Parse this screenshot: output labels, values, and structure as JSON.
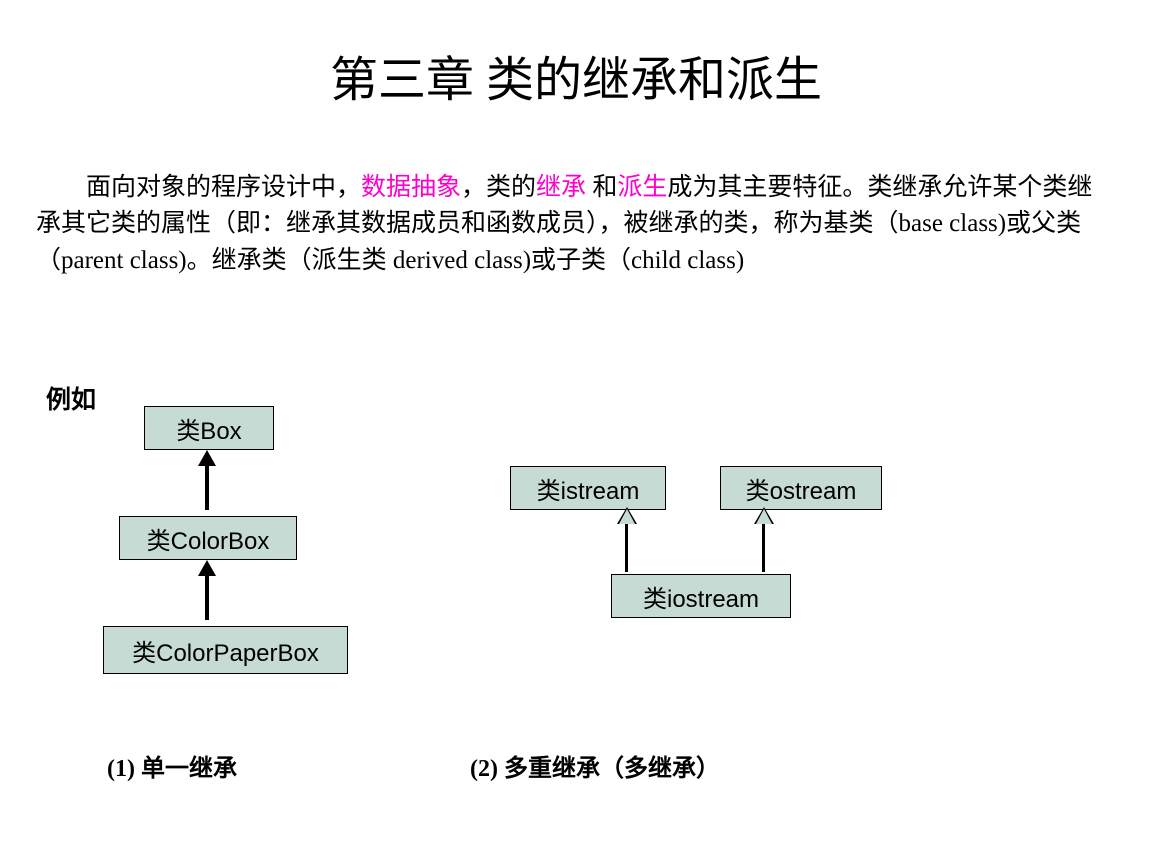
{
  "title": "第三章 类的继承和派生",
  "intro": {
    "seg1": "面向对象的程序设计中，",
    "pink1": "数据抽象",
    "seg2": "，类的",
    "pink2": "继承",
    "seg3": " 和",
    "pink3": "派生",
    "seg4": "成为其主要特征。类继承允许某个类继承其它类的属性（即：继承其数据成员和函数成员），被继承的类，称为基类（base class)或父类（parent class)。继承类（派生类 derived class)或子类（child class)"
  },
  "example_label": "例如",
  "diagram1": {
    "box1": "类Box",
    "box2": "类ColorBox",
    "box3": "类ColorPaperBox",
    "caption": "(1) 单一继承"
  },
  "diagram2": {
    "box1": "类istream",
    "box2": "类ostream",
    "box3": "类iostream",
    "caption": "(2) 多重继承（多继承）"
  },
  "chart_data": [
    {
      "type": "diagram",
      "title": "单一继承",
      "nodes": [
        "类Box",
        "类ColorBox",
        "类ColorPaperBox"
      ],
      "edges": [
        {
          "from": "类ColorBox",
          "to": "类Box"
        },
        {
          "from": "类ColorPaperBox",
          "to": "类ColorBox"
        }
      ]
    },
    {
      "type": "diagram",
      "title": "多重继承（多继承）",
      "nodes": [
        "类istream",
        "类ostream",
        "类iostream"
      ],
      "edges": [
        {
          "from": "类iostream",
          "to": "类istream"
        },
        {
          "from": "类iostream",
          "to": "类ostream"
        }
      ]
    }
  ]
}
